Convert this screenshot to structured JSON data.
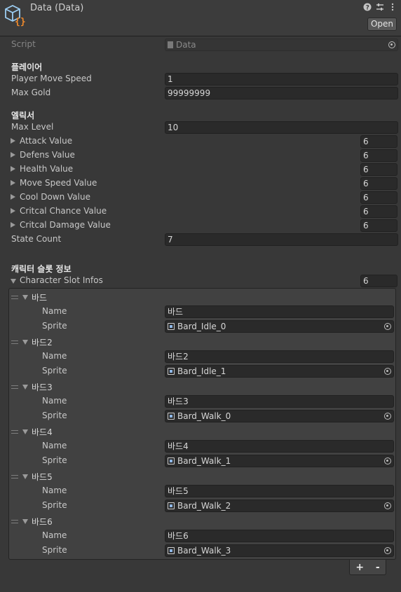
{
  "header": {
    "title": "Data (Data)",
    "help_icon": "question-icon",
    "settings_icon": "sliders-icon",
    "menu_icon": "kebab-icon",
    "open_label": "Open"
  },
  "script": {
    "label": "Script",
    "value": "Data"
  },
  "player_section": {
    "heading": "플레이어",
    "move_speed_label": "Player Move Speed",
    "move_speed_value": "1",
    "max_gold_label": "Max Gold",
    "max_gold_value": "99999999"
  },
  "elixir_section": {
    "heading": "엘릭서",
    "max_level_label": "Max Level",
    "max_level_value": "10",
    "arrays": [
      {
        "label": "Attack Value",
        "size": "6"
      },
      {
        "label": "Defens Value",
        "size": "6"
      },
      {
        "label": "Health Value",
        "size": "6"
      },
      {
        "label": "Move Speed Value",
        "size": "6"
      },
      {
        "label": "Cool Down Value",
        "size": "6"
      },
      {
        "label": "Critcal Chance Value",
        "size": "6"
      },
      {
        "label": "Critcal Damage Value",
        "size": "6"
      }
    ],
    "state_count_label": "State Count",
    "state_count_value": "7"
  },
  "slot_section": {
    "heading": "캐릭터 슬롯 정보",
    "list_label": "Character Slot Infos",
    "list_size": "6",
    "name_label": "Name",
    "sprite_label": "Sprite",
    "elements": [
      {
        "title": "바드",
        "name": "바드",
        "sprite": "Bard_Idle_0"
      },
      {
        "title": "바드2",
        "name": "바드2",
        "sprite": "Bard_Idle_1"
      },
      {
        "title": "바드3",
        "name": "바드3",
        "sprite": "Bard_Walk_0"
      },
      {
        "title": "바드4",
        "name": "바드4",
        "sprite": "Bard_Walk_1"
      },
      {
        "title": "바드5",
        "name": "바드5",
        "sprite": "Bard_Walk_2"
      },
      {
        "title": "바드6",
        "name": "바드6",
        "sprite": "Bard_Walk_3"
      }
    ],
    "add_label": "+",
    "remove_label": "-"
  }
}
